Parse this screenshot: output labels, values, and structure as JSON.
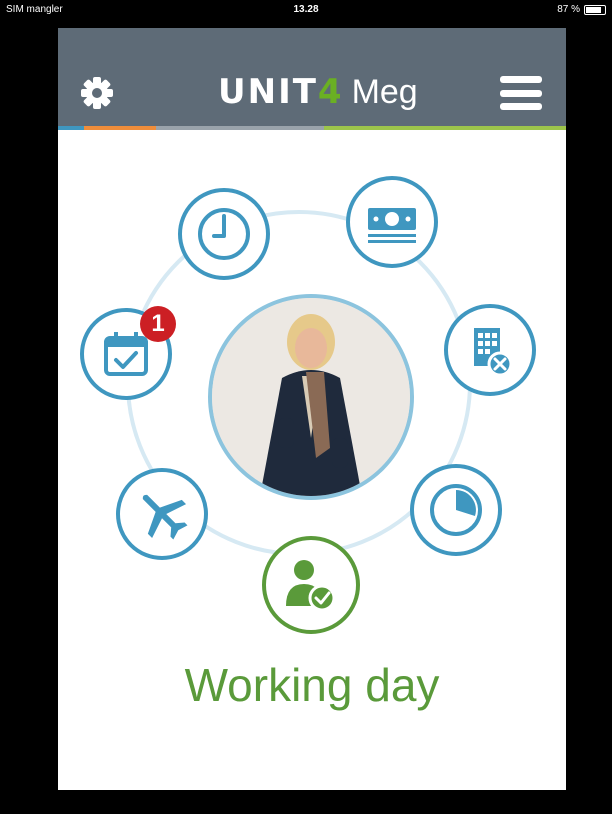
{
  "status_bar": {
    "carrier": "SIM mangler",
    "time": "13.28",
    "battery": "87 %",
    "battery_level": 0.87
  },
  "header": {
    "brand": "UNIT",
    "brand_four": "4",
    "sub": "Meg",
    "settings_icon": "gear-icon",
    "menu_icon": "hamburger-menu-icon"
  },
  "color_strip": [
    "#3f97c0",
    "#ef8d3a",
    "#9aa3ab",
    "#9dc54b"
  ],
  "features": {
    "time": {
      "icon": "clock-icon"
    },
    "expenses": {
      "icon": "money-icon"
    },
    "approvals": {
      "icon": "calendar-check-icon",
      "badge": "1"
    },
    "absence": {
      "icon": "building-remove-icon"
    },
    "travel": {
      "icon": "airplane-icon"
    },
    "reports": {
      "icon": "pie-chart-icon"
    },
    "presence": {
      "icon": "person-check-icon"
    }
  },
  "presence_status": "Working day",
  "colors": {
    "accent_blue": "#3f97c0",
    "accent_green": "#5a9a3a",
    "badge_red": "#cc1f24",
    "header": "#5e6b77"
  }
}
